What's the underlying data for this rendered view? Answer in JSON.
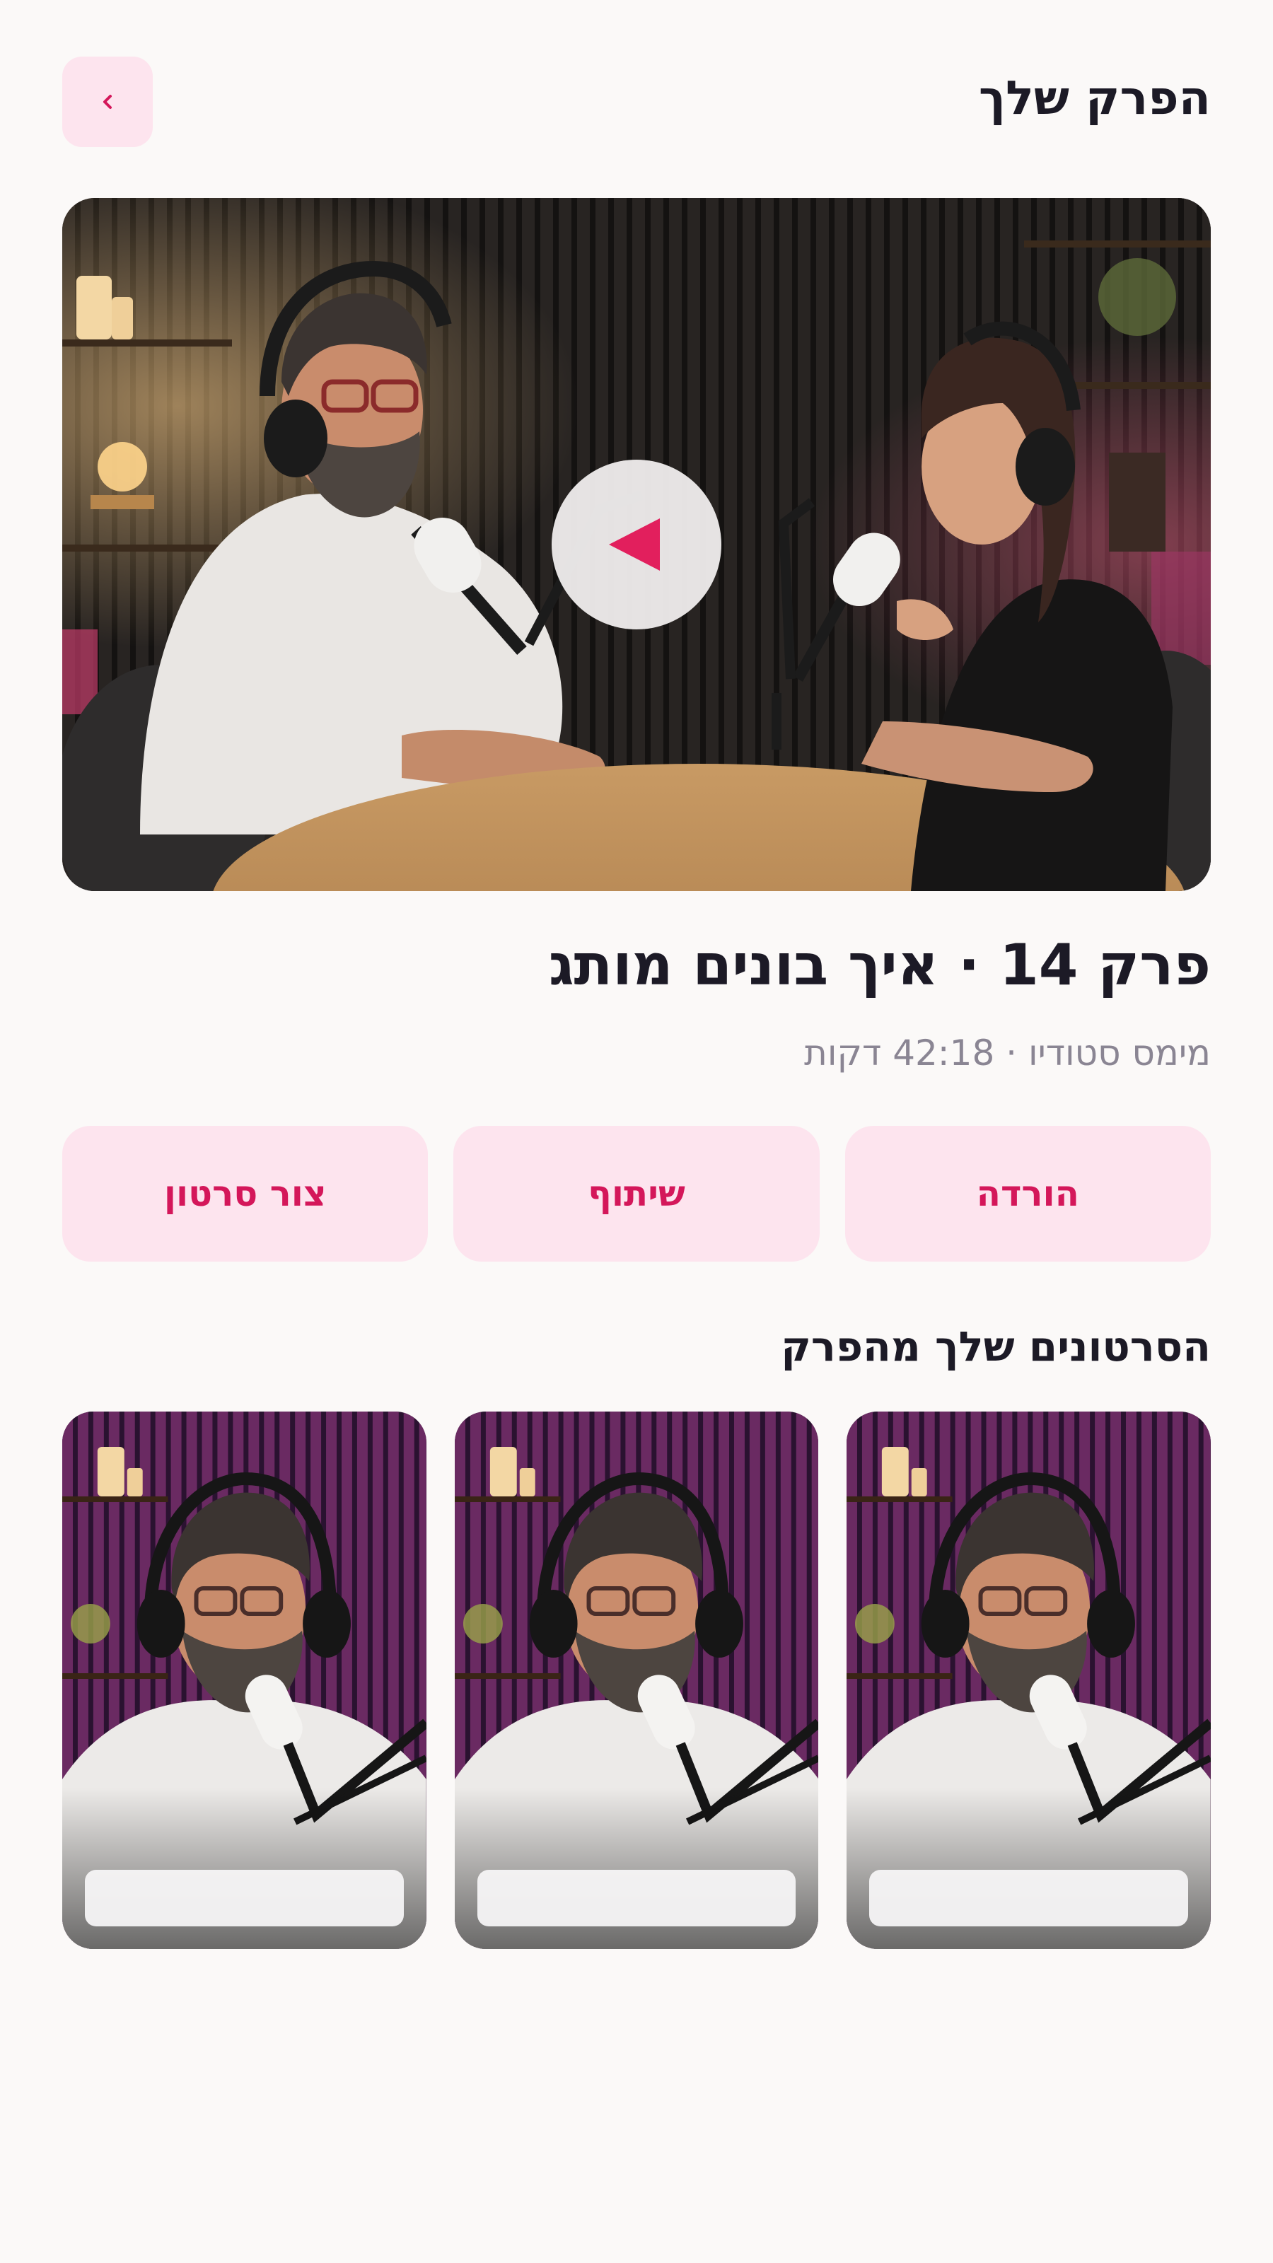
{
  "header": {
    "title": "הפרק שלך",
    "back_icon": "chevron-left-icon"
  },
  "hero": {
    "play_icon": "play-icon"
  },
  "episode": {
    "title": "פרק 14 · איך בונים מותג",
    "meta": "מימס סטודיו · 42:18 דקות"
  },
  "actions": [
    {
      "label": "הורדה"
    },
    {
      "label": "שיתוף"
    },
    {
      "label": "צור סרטון"
    }
  ],
  "clips_section": {
    "title": "הסרטונים שלך מהפרק",
    "clips": [
      {
        "caption": ""
      },
      {
        "caption": ""
      },
      {
        "caption": ""
      }
    ]
  },
  "colors": {
    "accent": "#e21f5d",
    "accent_text": "#d4175a",
    "pill_bg": "#fde4ee",
    "background": "#fbf9f8"
  }
}
